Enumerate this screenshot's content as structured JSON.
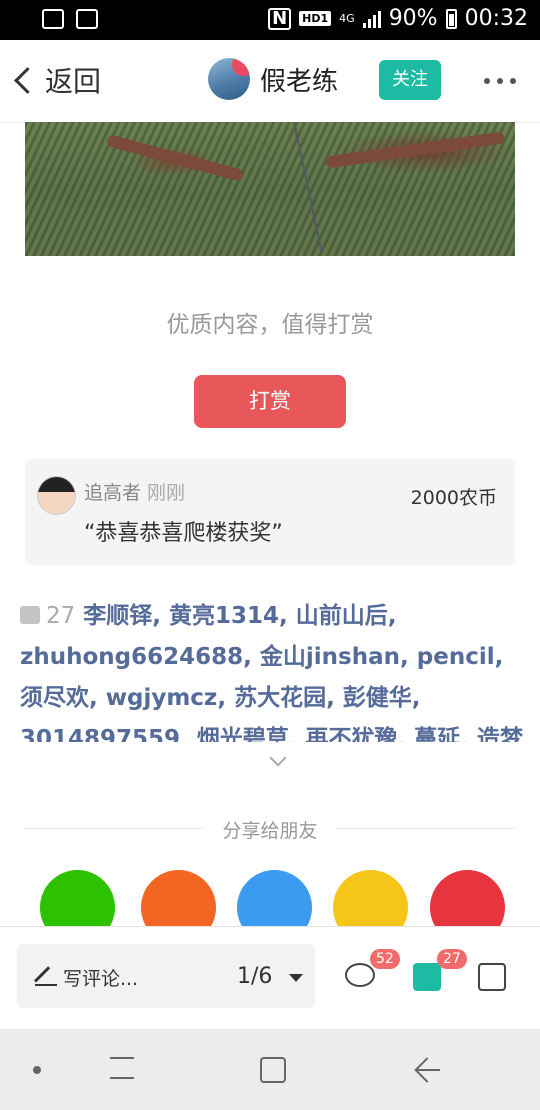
{
  "status_bar": {
    "battery": "90%",
    "time": "00:32",
    "network": "4G",
    "hd": "HD1",
    "nfc": "N"
  },
  "header": {
    "back_label": "返回",
    "author_name": "假老练",
    "follow_label": "关注"
  },
  "reward": {
    "prompt": "优质内容，值得打赏",
    "button_label": "打赏"
  },
  "tip": {
    "user": "追高者",
    "time": "刚刚",
    "amount": "2000农币",
    "message": "“恭喜恭喜爬楼获奖”"
  },
  "likes": {
    "count": "27",
    "names": "李顺铎, 黄亮1314, 山前山后, zhuhong6624688, 金山jinshan, pencil, 须尽欢, wgjymcz, 苏大花园, 彭健华, 3014897559, 烟光碧草, 再不犹豫, 蔓延, 造梦者, 黄云霞, 天上"
  },
  "share": {
    "title": "分享给朋友",
    "targets": [
      {
        "name": "wechat",
        "color": "#2dc100"
      },
      {
        "name": "moments",
        "color": "#f26522"
      },
      {
        "name": "qq",
        "color": "#3a9bf0"
      },
      {
        "name": "qzone",
        "color": "#f5c518"
      },
      {
        "name": "weibo",
        "color": "#e6353f"
      }
    ]
  },
  "bottom_bar": {
    "comment_placeholder": "写评论...",
    "page_indicator": "1/6",
    "comment_count": "52",
    "like_count": "27"
  },
  "colors": {
    "accent": "#1dbba3",
    "reward": "#e8585a",
    "link": "#556b99",
    "badge": "#f26b6b"
  }
}
